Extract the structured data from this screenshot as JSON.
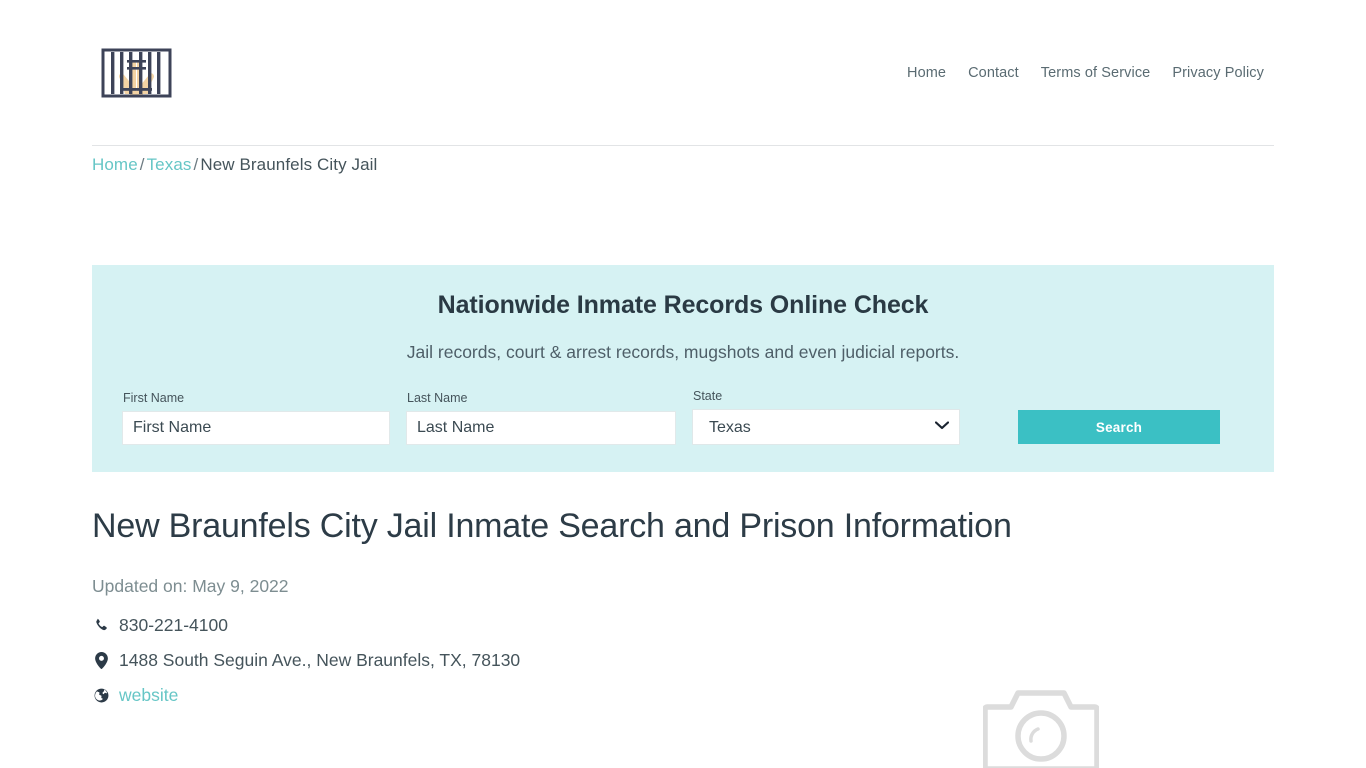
{
  "header": {
    "logo_name": "jail-bars-logo",
    "nav": [
      {
        "label": "Home"
      },
      {
        "label": "Contact"
      },
      {
        "label": "Terms of Service"
      },
      {
        "label": "Privacy Policy"
      }
    ]
  },
  "breadcrumb": {
    "home": "Home",
    "state": "Texas",
    "current": "New Braunfels City Jail",
    "separator": "/"
  },
  "search_panel": {
    "title": "Nationwide Inmate Records Online Check",
    "subtitle": "Jail records, court & arrest records, mugshots and even judicial reports.",
    "first_name": {
      "label": "First Name",
      "placeholder": "First Name",
      "value": ""
    },
    "last_name": {
      "label": "Last Name",
      "placeholder": "Last Name",
      "value": ""
    },
    "state": {
      "label": "State",
      "selected": "Texas",
      "options": [
        "Texas"
      ]
    },
    "search_button": "Search",
    "background_color": "#d6f2f3",
    "button_color": "#3bc0c4"
  },
  "main": {
    "title": "New Braunfels City Jail Inmate Search and Prison Information",
    "updated": "Updated on: May 9, 2022",
    "details": [
      {
        "icon": "phone-icon",
        "text": "830-221-4100",
        "link": false
      },
      {
        "icon": "map-pin-icon",
        "text": "1488 South Seguin Ave., New Braunfels, TX, 78130",
        "link": false
      },
      {
        "icon": "globe-icon",
        "text": "website",
        "link": true
      }
    ],
    "image_placeholder": "camera-placeholder-icon"
  },
  "colors": {
    "accent": "#66c6c6",
    "button": "#3bc0c4",
    "panel": "#d6f2f3",
    "text": "#45545b"
  }
}
